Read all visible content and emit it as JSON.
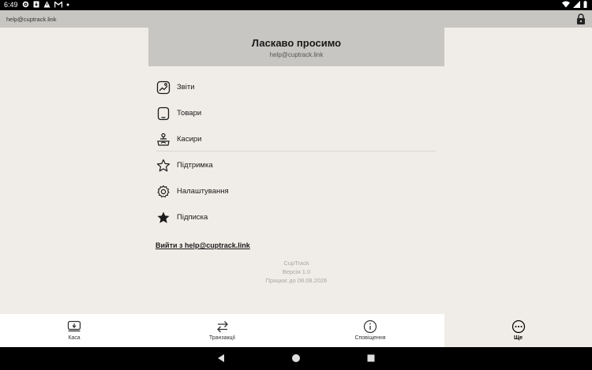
{
  "status_bar": {
    "time": "6:49"
  },
  "browser": {
    "url": "help@cuptrack.link"
  },
  "header": {
    "title": "Ласкаво просимо",
    "email": "help@cuptrack.link"
  },
  "menu": {
    "items": [
      {
        "label": "Звіти",
        "icon": "reports-icon"
      },
      {
        "label": "Товари",
        "icon": "products-icon"
      },
      {
        "label": "Касири",
        "icon": "cashiers-icon"
      },
      {
        "label": "Підтримка",
        "icon": "star-outline-icon"
      },
      {
        "label": "Налаштування",
        "icon": "gear-icon"
      },
      {
        "label": "Підписка",
        "icon": "star-filled-icon"
      }
    ]
  },
  "logout": {
    "label": "Вийти з help@cuptrack.link"
  },
  "app_info": {
    "name": "CupTrack",
    "version": "Версія 1.0",
    "valid_until": "Працює до 08.08.2026"
  },
  "bottom_nav": {
    "items": [
      {
        "label": "Каса",
        "icon": "register-icon",
        "active": false
      },
      {
        "label": "Транзакції",
        "icon": "transfer-arrows-icon",
        "active": false
      },
      {
        "label": "Сповіщення",
        "icon": "info-icon",
        "active": false
      },
      {
        "label": "Ще",
        "icon": "more-icon",
        "active": true
      }
    ]
  }
}
